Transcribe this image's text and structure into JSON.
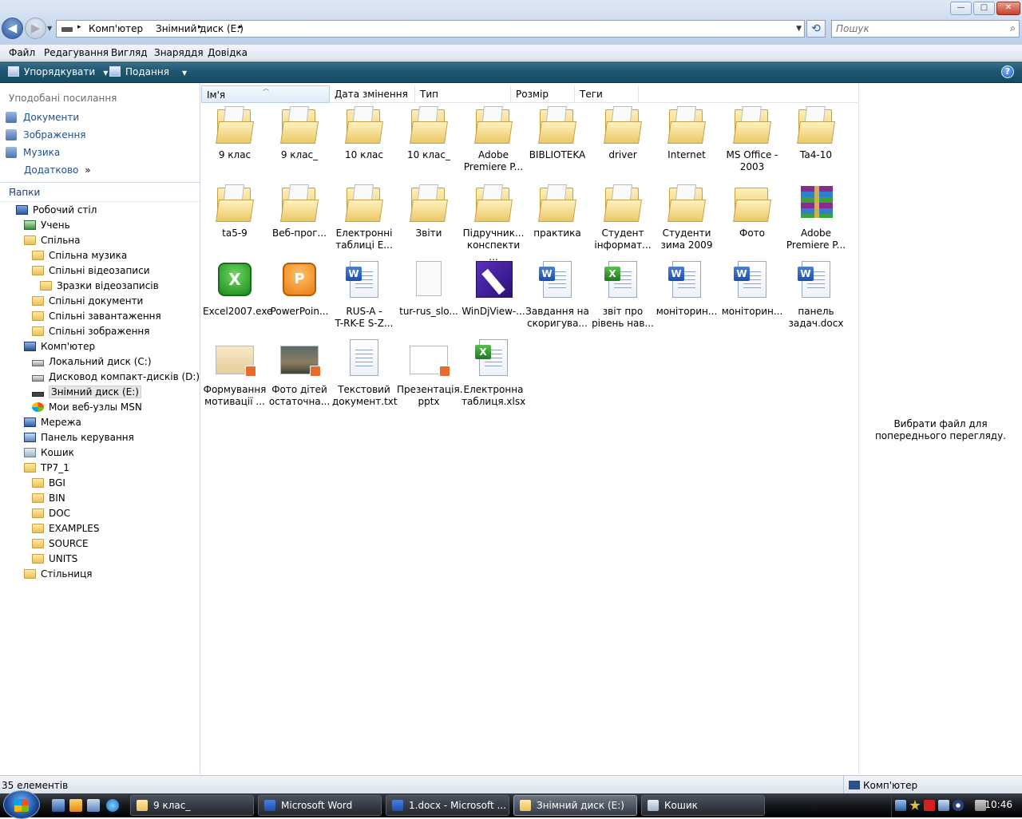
{
  "window": {
    "controls": [
      "—",
      "□",
      "✕"
    ]
  },
  "address": {
    "crumbs": [
      "Комп'ютер",
      "Знімний диск (E:)"
    ],
    "sep": "▸"
  },
  "search": {
    "placeholder": "Пошук"
  },
  "menu": [
    "Файл",
    "Редагування",
    "Вигляд",
    "Знаряддя",
    "Довідка"
  ],
  "commands": {
    "organize": "Упорядкувати",
    "views": "Подання"
  },
  "favorites": {
    "header": "Уподобані посилання",
    "items": [
      "Документи",
      "Зображення",
      "Музика"
    ],
    "more": "Додатково",
    "more_chevron": "»"
  },
  "folders_header": "Папки",
  "tree": [
    "Робочий стіл",
    "Учень",
    "Спільна",
    "Спільна музика",
    "Спільні відеозаписи",
    "Зразки відеозаписів",
    "Спільні документи",
    "Спільні завантаження",
    "Спільні зображення",
    "Комп'ютер",
    "Локальний диск (C:)",
    "Дисковод компакт-дисків (D:)",
    "Знімний диск (E:)",
    "Мои веб-узлы MSN",
    "Мережа",
    "Панель керування",
    "Кошик",
    "TP7_1",
    "BGI",
    "BIN",
    "DOC",
    "EXAMPLES",
    "SOURCE",
    "UNITS",
    "Стільниця"
  ],
  "columns": [
    "Ім'я",
    "Дата змінення",
    "Тип",
    "Розмір",
    "Теги"
  ],
  "files": [
    {
      "l1": "9 клас",
      "l2": "",
      "icon": "folder-doc-icon"
    },
    {
      "l1": "9 клас_",
      "l2": "",
      "icon": "folder-doc-icon"
    },
    {
      "l1": "10 клас",
      "l2": "",
      "icon": "folder-doc-icon"
    },
    {
      "l1": "10 клас_",
      "l2": "",
      "icon": "folder-doc-icon"
    },
    {
      "l1": "Adobe",
      "l2": "Premiere P...",
      "icon": "folder-doc-icon"
    },
    {
      "l1": "BIBLIOTEKA",
      "l2": "",
      "icon": "folder-doc-icon"
    },
    {
      "l1": "driver",
      "l2": "",
      "icon": "folder-doc-icon"
    },
    {
      "l1": "Internet",
      "l2": "",
      "icon": "folder-doc-icon"
    },
    {
      "l1": "MS Office -",
      "l2": "2003",
      "icon": "folder-doc-icon"
    },
    {
      "l1": "Ta4-10",
      "l2": "",
      "icon": "folder-doc-icon"
    },
    {
      "l1": "ta5-9",
      "l2": "",
      "icon": "folder-doc-icon"
    },
    {
      "l1": "Веб-прог...",
      "l2": "",
      "icon": "folder-doc-icon"
    },
    {
      "l1": "Електронні",
      "l2": "таблиці Е...",
      "icon": "folder-doc-icon"
    },
    {
      "l1": "Звіти",
      "l2": "",
      "icon": "folder-doc-icon"
    },
    {
      "l1": "Підручник...",
      "l2": "конспекти ...",
      "icon": "folder-doc-icon"
    },
    {
      "l1": "практика",
      "l2": "",
      "icon": "folder-doc-icon"
    },
    {
      "l1": "Студент",
      "l2": "інформат...",
      "icon": "folder-doc-icon"
    },
    {
      "l1": "Студенти",
      "l2": "зима 2009",
      "icon": "folder-doc-icon"
    },
    {
      "l1": "Фото",
      "l2": "",
      "icon": "folder-icon"
    },
    {
      "l1": "Adobe",
      "l2": "Premiere P...",
      "icon": "winrar-icon"
    },
    {
      "l1": "Excel2007.exe",
      "l2": "",
      "icon": "excel-app-icon"
    },
    {
      "l1": "PowerPoin...",
      "l2": "",
      "icon": "powerpoint-app-icon"
    },
    {
      "l1": "RUS-A -",
      "l2": "T-RK-E S-Z...",
      "icon": "word-doc-icon"
    },
    {
      "l1": "tur-rus_slo...",
      "l2": "",
      "icon": "blank-file-icon"
    },
    {
      "l1": "WinDjView-...",
      "l2": "",
      "icon": "windjview-icon"
    },
    {
      "l1": "Завдання на",
      "l2": "скоригува...",
      "icon": "word-doc-icon"
    },
    {
      "l1": "звіт про",
      "l2": "рівень нав...",
      "icon": "excel-sheet-icon"
    },
    {
      "l1": "моніторин...",
      "l2": "",
      "icon": "word-doc-icon"
    },
    {
      "l1": "моніторин...",
      "l2": "",
      "icon": "word-doc-icon"
    },
    {
      "l1": "панель",
      "l2": "задач.docx",
      "icon": "word-doc-icon"
    },
    {
      "l1": "Формування",
      "l2": "мотивації ...",
      "icon": "pptx-thumb-icon"
    },
    {
      "l1": "Фото дітей",
      "l2": "остаточна...",
      "icon": "pptx-photo-thumb-icon"
    },
    {
      "l1": "Текстовий",
      "l2": "документ.txt",
      "icon": "text-file-icon"
    },
    {
      "l1": "Презентація.",
      "l2": "pptx",
      "icon": "pptx-blank-icon"
    },
    {
      "l1": "Електронна",
      "l2": "таблиця.xlsx",
      "icon": "excel-sheet-icon"
    }
  ],
  "preview": "Вибрати файл для попереднього перегляду.",
  "status": {
    "count": "35 елементів",
    "location": "Комп'ютер"
  },
  "taskbar": {
    "buttons": [
      "9 клас_",
      "Microsoft Word",
      "1.docx - Microsoft ...",
      "Знімний диск (E:)",
      "Кошик"
    ],
    "clock": "10:46"
  }
}
